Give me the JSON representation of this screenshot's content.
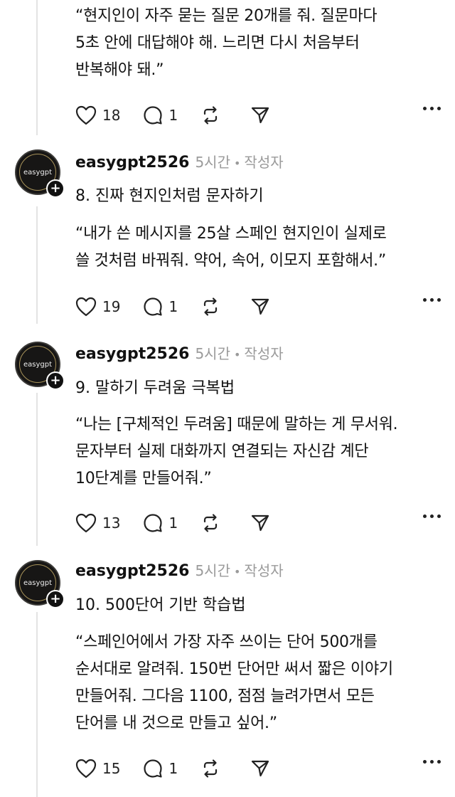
{
  "posts": [
    {
      "username": "",
      "time": "",
      "role": "",
      "title": "",
      "body": "“현지인이 자주 묻는 질문 20개를 줘. 질문마다\n5초 안에 대답해야 해. 느리면 다시 처음부터\n반복해야 돼.”",
      "likes": "18",
      "replies": "1"
    },
    {
      "username": "easygpt2526",
      "time": "5시간",
      "role": "작성자",
      "title": "8. 진짜 현지인처럼 문자하기",
      "body": "“내가 쓴 메시지를 25살 스페인 현지인이 실제로\n쓸 것처럼 바꿔줘. 약어, 속어, 이모지 포함해서.”",
      "likes": "19",
      "replies": "1"
    },
    {
      "username": "easygpt2526",
      "time": "5시간",
      "role": "작성자",
      "title": "9. 말하기 두려움 극복법",
      "body": "“나는 [구체적인 두려움] 때문에 말하는 게 무서워.\n문자부터 실제 대화까지 연결되는 자신감 계단\n10단계를 만들어줘.”",
      "likes": "13",
      "replies": "1"
    },
    {
      "username": "easygpt2526",
      "time": "5시간",
      "role": "작성자",
      "title": "10. 500단어 기반 학습법",
      "body": "“스페인어에서 가장 자주 쓰이는 단어 500개를\n순서대로 알려줘. 150번 단어만 써서 짧은 이야기\n만들어줘. 그다음 1100, 점점 늘려가면서 모든\n단어를 내 것으로 만들고 싶어.”",
      "likes": "15",
      "replies": "1"
    }
  ],
  "avatar_logo_text": "easygpt",
  "icons": [
    "heart-icon",
    "comment-icon",
    "repost-icon",
    "share-icon",
    "more-icon",
    "follow-plus-icon"
  ]
}
